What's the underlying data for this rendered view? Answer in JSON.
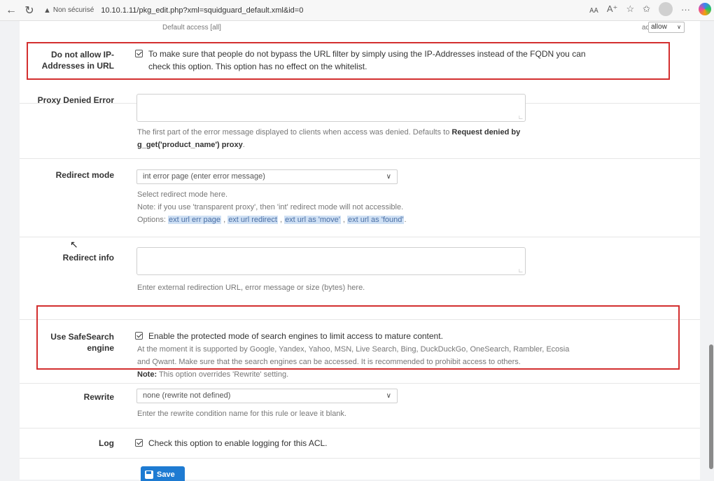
{
  "browser": {
    "insecure_label": "Non sécurisé",
    "url": "10.10.1.11/pkg_edit.php?xml=squidguard_default.xml&id=0"
  },
  "top_row": {
    "default_access": "Default access [all]",
    "access_label": "access",
    "access_value": "allow"
  },
  "ip_row": {
    "label_line1": "Do not allow IP-",
    "label_line2": "Addresses in URL",
    "text_line1": "To make sure that people do not bypass the URL filter by simply using the IP-Addresses instead of the FQDN you can",
    "text_line2": "check this option. This option has no effect on the whitelist.",
    "checked": true
  },
  "proxy_denied": {
    "label": "Proxy Denied Error",
    "value": "",
    "help_line1_prefix": "The first part of the error message displayed to clients when access was denied. Defaults to ",
    "help_line1_bold": "Request denied by",
    "help_line2": "g_get('product_name') proxy",
    "help_line2_end": "."
  },
  "redirect_mode": {
    "label": "Redirect mode",
    "selected": "int error page (enter error message)",
    "help_line1": "Select redirect mode here.",
    "help_line2": "Note: if you use 'transparent proxy', then 'int' redirect mode will not accessible.",
    "options_prefix": "Options: ",
    "options": [
      "ext url err page",
      "ext url redirect",
      "ext url as 'move'",
      "ext url as 'found'"
    ],
    "sep1": " , ",
    "sep2": " , ",
    "sep3": " , ",
    "end": "."
  },
  "redirect_info": {
    "label": "Redirect info",
    "value": "",
    "help": "Enter external redirection URL, error message or size (bytes) here."
  },
  "safesearch": {
    "label_line1": "Use SafeSearch",
    "label_line2": "engine",
    "checkbox_text": "Enable the protected mode of search engines to limit access to mature content.",
    "help_line1": "At the moment it is supported by Google, Yandex, Yahoo, MSN, Live Search, Bing, DuckDuckGo, OneSearch, Rambler, Ecosia",
    "help_line2": "and Qwant. Make sure that the search engines can be accessed. It is recommended to prohibit access to others.",
    "note_bold": "Note:",
    "note_text": " This option overrides 'Rewrite' setting.",
    "checked": true
  },
  "rewrite": {
    "label": "Rewrite",
    "selected": "none (rewrite not defined)",
    "help": "Enter the rewrite condition name for this rule or leave it blank."
  },
  "log": {
    "label": "Log",
    "checkbox_text": "Check this option to enable logging for this ACL.",
    "checked": true
  },
  "save_button": {
    "label": "Save"
  },
  "colors": {
    "highlight_border": "#d32f2f",
    "save_button": "#1e7bd2",
    "link_highlight": "#cfe0f4"
  }
}
